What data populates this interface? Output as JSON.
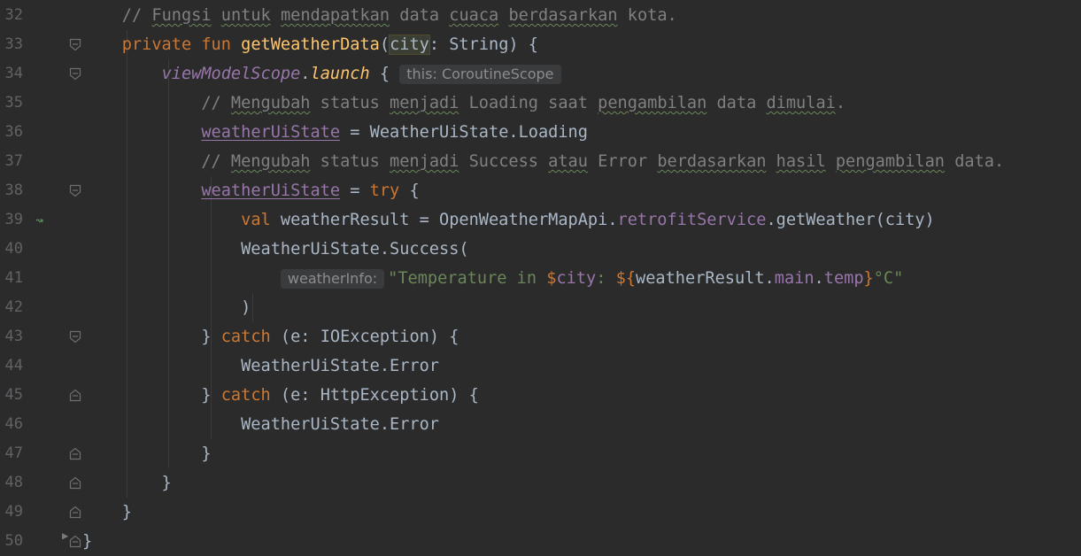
{
  "editor": {
    "lines": [
      {
        "n": "32",
        "segs": [
          [
            "    // ",
            "cmt"
          ],
          [
            "Fungsi",
            "cmt typo"
          ],
          [
            " ",
            "cmt"
          ],
          [
            "untuk",
            "cmt typo"
          ],
          [
            " ",
            "cmt"
          ],
          [
            "mendapatkan",
            "cmt typo"
          ],
          [
            " data ",
            "cmt"
          ],
          [
            "cuaca",
            "cmt typo"
          ],
          [
            " ",
            "cmt"
          ],
          [
            "berdasarkan",
            "cmt typo"
          ],
          [
            " kota.",
            "cmt"
          ]
        ],
        "fold": null
      },
      {
        "n": "33",
        "segs": [
          [
            "    ",
            ""
          ],
          [
            "private fun ",
            "kw"
          ],
          [
            "getWeatherData",
            "fn"
          ],
          [
            "(",
            ""
          ],
          [
            "city",
            "hl"
          ],
          [
            ": String) {",
            ""
          ]
        ],
        "fold": "open"
      },
      {
        "n": "34",
        "segs": [
          [
            "        ",
            ""
          ],
          [
            "viewModelScope",
            "ext"
          ],
          [
            ".",
            ""
          ],
          [
            "launch",
            "extf"
          ],
          [
            " { ",
            ""
          ],
          [
            "this: CoroutineScope",
            "hint"
          ]
        ],
        "fold": "open"
      },
      {
        "n": "35",
        "segs": [
          [
            "            // ",
            "cmt"
          ],
          [
            "Mengubah",
            "cmt typo"
          ],
          [
            " status ",
            "cmt"
          ],
          [
            "menjadi",
            "cmt typo"
          ],
          [
            " Loading saat ",
            "cmt"
          ],
          [
            "pengambilan",
            "cmt typo"
          ],
          [
            " data ",
            "cmt"
          ],
          [
            "dimulai",
            "cmt typo"
          ],
          [
            ".",
            "cmt"
          ]
        ],
        "fold": null
      },
      {
        "n": "36",
        "segs": [
          [
            "            ",
            ""
          ],
          [
            "weatherUiState",
            "propu"
          ],
          [
            " = WeatherUiState.Loading",
            ""
          ]
        ],
        "fold": null
      },
      {
        "n": "37",
        "segs": [
          [
            "            // ",
            "cmt"
          ],
          [
            "Mengubah",
            "cmt typo"
          ],
          [
            " status ",
            "cmt"
          ],
          [
            "menjadi",
            "cmt typo"
          ],
          [
            " Success ",
            "cmt"
          ],
          [
            "atau",
            "cmt typo"
          ],
          [
            " Error ",
            "cmt"
          ],
          [
            "berdasarkan",
            "cmt typo"
          ],
          [
            " ",
            "cmt"
          ],
          [
            "hasil",
            "cmt typo"
          ],
          [
            " ",
            "cmt"
          ],
          [
            "pengambilan",
            "cmt typo"
          ],
          [
            " data.",
            "cmt"
          ]
        ],
        "fold": null
      },
      {
        "n": "38",
        "segs": [
          [
            "            ",
            ""
          ],
          [
            "weatherUiState",
            "propu"
          ],
          [
            " = ",
            ""
          ],
          [
            "try",
            "kw"
          ],
          [
            " {",
            ""
          ]
        ],
        "fold": "open"
      },
      {
        "n": "39",
        "segs": [
          [
            "                ",
            ""
          ],
          [
            "val ",
            "kw"
          ],
          [
            "weatherResult = OpenWeatherMapApi.",
            ""
          ],
          [
            "retrofitService",
            "prop"
          ],
          [
            ".getWeather(city)",
            ""
          ]
        ],
        "fold": null
      },
      {
        "n": "40",
        "segs": [
          [
            "                WeatherUiState.Success(",
            ""
          ]
        ],
        "fold": null
      },
      {
        "n": "41",
        "segs": [
          [
            "                    ",
            ""
          ],
          [
            "weatherInfo:",
            "hint"
          ],
          [
            "\"Temperature in ",
            "str"
          ],
          [
            "$",
            "tpl"
          ],
          [
            "city",
            "prop"
          ],
          [
            ": ",
            "str"
          ],
          [
            "${",
            "tpl"
          ],
          [
            "weatherResult.",
            ""
          ],
          [
            "main",
            "prop"
          ],
          [
            ".",
            ""
          ],
          [
            "temp",
            "prop"
          ],
          [
            "}",
            "tpl"
          ],
          [
            "°C\"",
            "str"
          ]
        ],
        "fold": null
      },
      {
        "n": "42",
        "segs": [
          [
            "                )",
            ""
          ]
        ],
        "fold": null
      },
      {
        "n": "43",
        "segs": [
          [
            "            } ",
            ""
          ],
          [
            "catch",
            "kw"
          ],
          [
            " (e: IOException) {",
            ""
          ]
        ],
        "fold": "open"
      },
      {
        "n": "44",
        "segs": [
          [
            "                WeatherUiState.Error",
            ""
          ]
        ],
        "fold": null
      },
      {
        "n": "45",
        "segs": [
          [
            "            } ",
            ""
          ],
          [
            "catch",
            "kw"
          ],
          [
            " (e: HttpException) {",
            ""
          ]
        ],
        "fold": "close"
      },
      {
        "n": "46",
        "segs": [
          [
            "                WeatherUiState.Error",
            ""
          ]
        ],
        "fold": null
      },
      {
        "n": "47",
        "segs": [
          [
            "            }",
            ""
          ]
        ],
        "fold": "close"
      },
      {
        "n": "48",
        "segs": [
          [
            "        }",
            ""
          ]
        ],
        "fold": "close"
      },
      {
        "n": "49",
        "segs": [
          [
            "    }",
            ""
          ]
        ],
        "fold": "close"
      },
      {
        "n": "50",
        "segs": [
          [
            "}",
            ""
          ]
        ],
        "fold": "close"
      }
    ],
    "gutter_icon": {
      "line": "39",
      "name": "suspend-call-icon",
      "glyph": "↝"
    },
    "breakpoint_marker": {
      "line": "50",
      "name": "run-arrow-icon",
      "glyph": "▶"
    },
    "colors": {
      "background": "#2b2b2b",
      "keyword": "#cc7832",
      "function": "#ffc66d",
      "property": "#9876aa",
      "string": "#6a8759",
      "comment": "#808080",
      "text": "#a9b7c6"
    }
  }
}
